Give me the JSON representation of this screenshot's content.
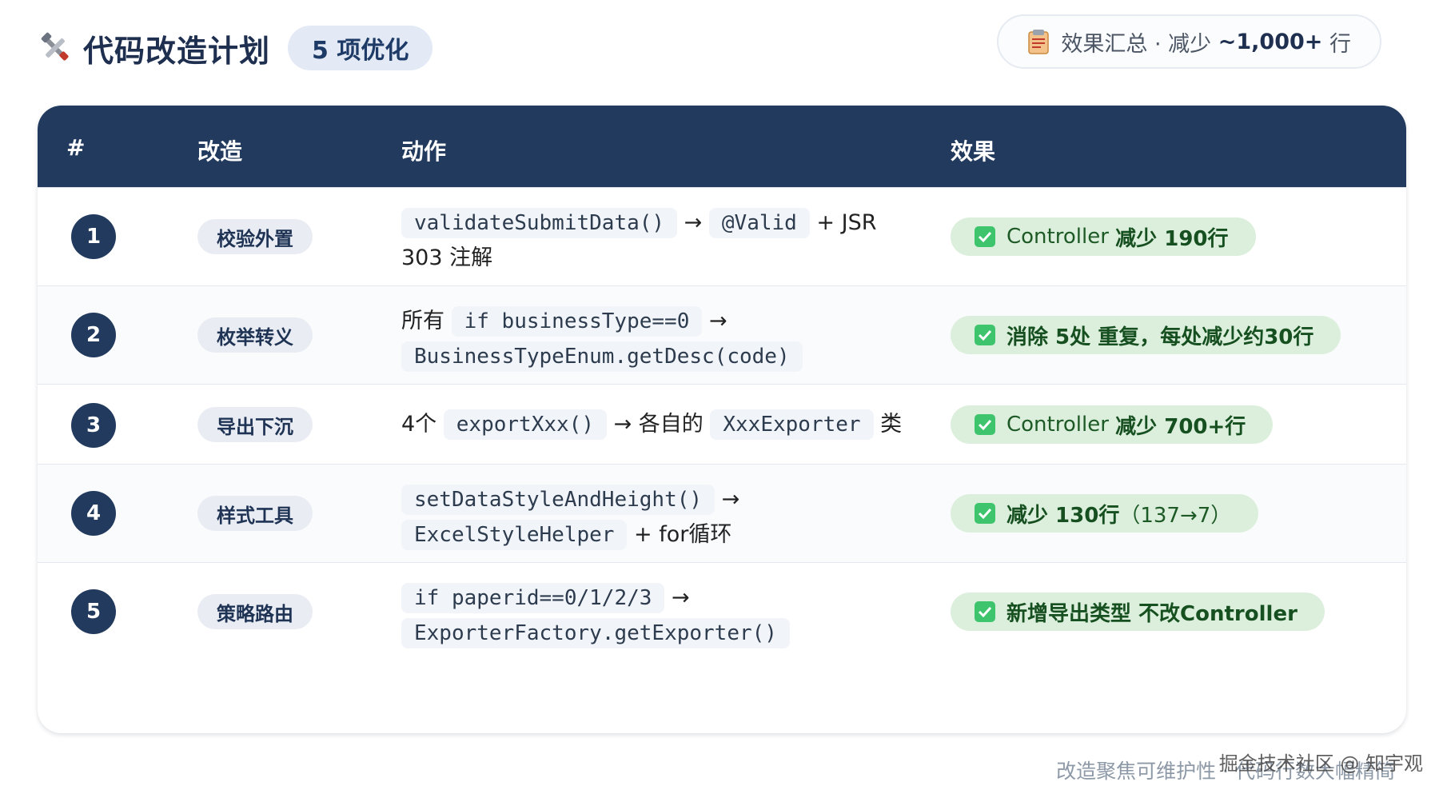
{
  "header": {
    "title": "代码改造计划",
    "count_badge": "5 项优化",
    "summary_prefix": "效果汇总 · 减少",
    "summary_value": "~1,000+",
    "summary_suffix": "行"
  },
  "table": {
    "columns": [
      "#",
      "改造",
      "动作",
      "效果"
    ],
    "rows": [
      {
        "num": "1",
        "tag": "校验外置",
        "action": {
          "code1": "validateSubmitData()",
          "arrow": "→",
          "code2": "@Valid",
          "tail": "+ JSR",
          "line2": "303 注解"
        },
        "effect": {
          "a": "Controller",
          "b": "减少 190行"
        }
      },
      {
        "num": "2",
        "tag": "枚举转义",
        "action": {
          "pre": "所有",
          "code1": "if businessType==0",
          "arrow": "→",
          "code2": "BusinessTypeEnum.getDesc(code)"
        },
        "effect": {
          "a": "消除 5处 重复，每处减少约30行"
        }
      },
      {
        "num": "3",
        "tag": "导出下沉",
        "action": {
          "pre": "4个",
          "code1": "exportXxx()",
          "mid": "→ 各自的",
          "code2": "XxxExporter",
          "tail": "类"
        },
        "effect": {
          "a": "Controller",
          "b": "减少 700+行"
        }
      },
      {
        "num": "4",
        "tag": "样式工具",
        "action": {
          "code1": "setDataStyleAndHeight()",
          "arrow": "→",
          "code2": "ExcelStyleHelper",
          "tail": "+ for循环"
        },
        "effect": {
          "a": "减少 130行",
          "b": "（137→7）"
        }
      },
      {
        "num": "5",
        "tag": "策略路由",
        "action": {
          "code1": "if paperid==0/1/2/3",
          "arrow": "→",
          "code2": "ExporterFactory.getExporter()"
        },
        "effect": {
          "a": "新增导出类型 不改Controller"
        }
      }
    ]
  },
  "footer": {
    "note": "改造聚焦可维护性 · 代码行数大幅精简",
    "watermark": "掘金技术社区 @ 知宇观"
  },
  "colors": {
    "header_bg": "#223a5e",
    "accent": "#1e2f4f",
    "effect_bg": "#dcefdc",
    "effect_text": "#1d5a26"
  },
  "icons": [
    "tools-icon",
    "clipboard-icon",
    "check-icon"
  ]
}
